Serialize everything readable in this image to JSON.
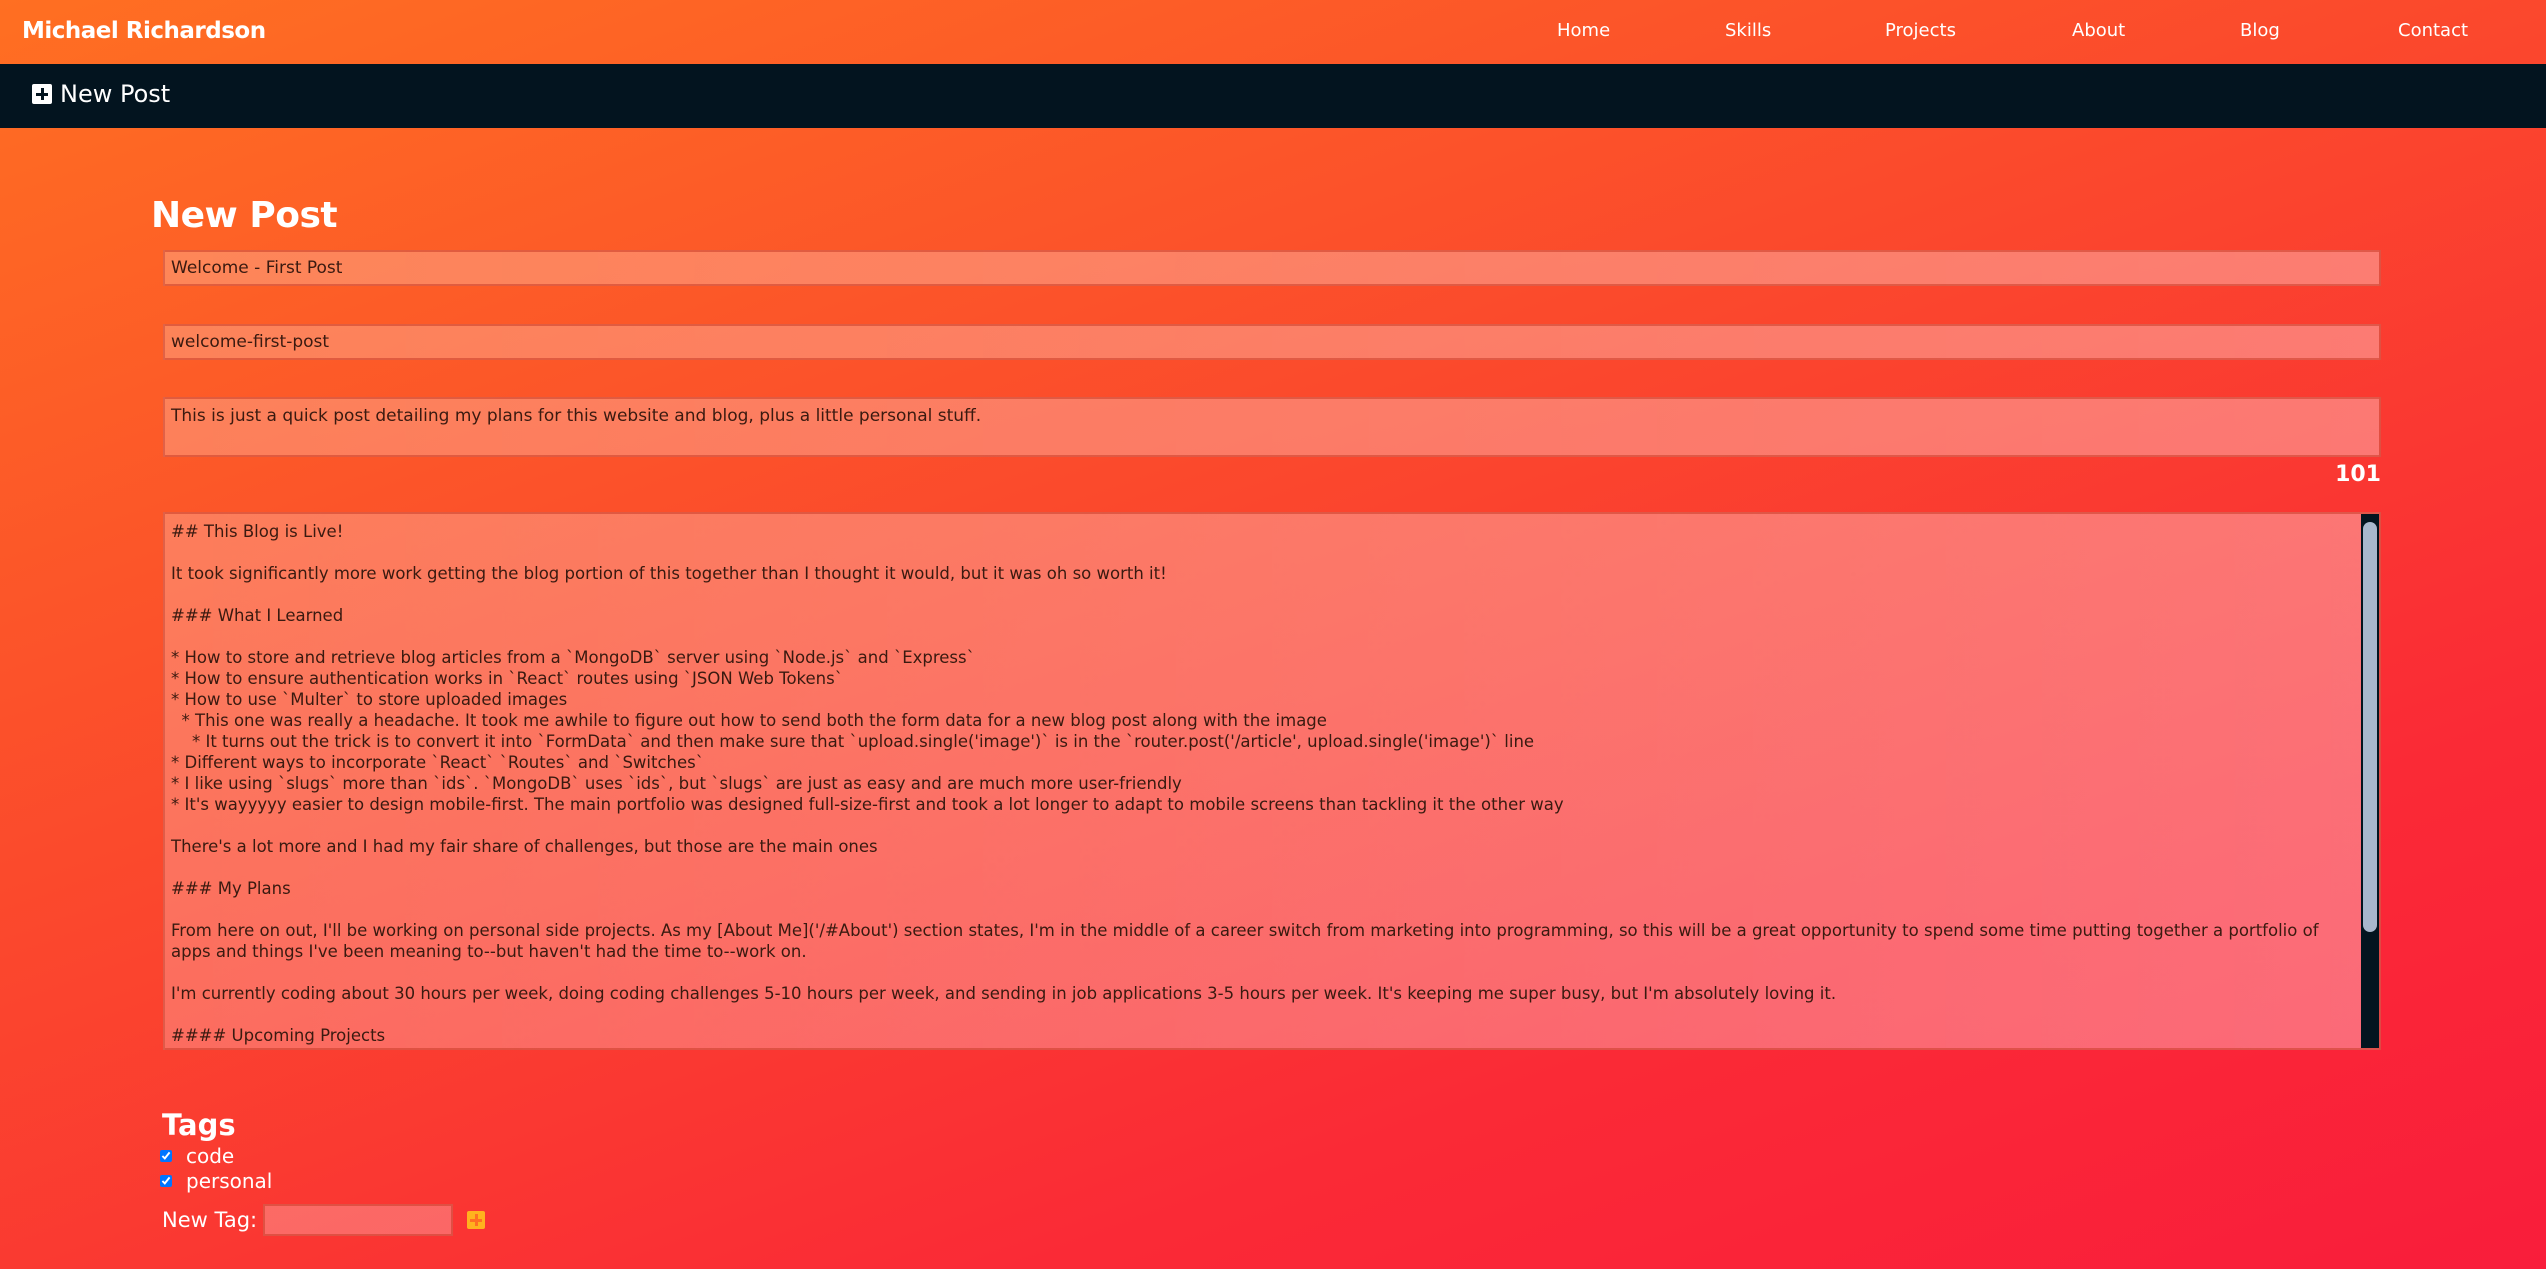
{
  "nav": {
    "brand": "Michael Richardson",
    "links": [
      {
        "label": "Home"
      },
      {
        "label": "Skills"
      },
      {
        "label": "Projects"
      },
      {
        "label": "About"
      },
      {
        "label": "Blog"
      },
      {
        "label": "Contact"
      }
    ]
  },
  "admin_bar": {
    "new_post_label": "New Post",
    "icon": "plus-square-icon"
  },
  "form": {
    "heading": "New Post",
    "title_value": "Welcome - First Post",
    "slug_value": "welcome-first-post",
    "excerpt_value": "This is just a quick post detailing my plans for this website and blog, plus a little personal stuff.",
    "excerpt_count": "101",
    "content_value": "## This Blog is Live!\n\nIt took significantly more work getting the blog portion of this together than I thought it would, but it was oh so worth it!\n\n### What I Learned\n\n* How to store and retrieve blog articles from a `MongoDB` server using `Node.js` and `Express`\n* How to ensure authentication works in `React` routes using `JSON Web Tokens`\n* How to use `Multer` to store uploaded images\n  * This one was really a headache. It took me awhile to figure out how to send both the form data for a new blog post along with the image\n    * It turns out the trick is to convert it into `FormData` and then make sure that `upload.single('image')` is in the `router.post('/article', upload.single('image')` line\n* Different ways to incorporate `React` `Routes` and `Switches`\n* I like using `slugs` more than `ids`. `MongoDB` uses `ids`, but `slugs` are just as easy and are much more user-friendly\n* It's wayyyyy easier to design mobile-first. The main portfolio was designed full-size-first and took a lot longer to adapt to mobile screens than tackling it the other way\n\nThere's a lot more and I had my fair share of challenges, but those are the main ones\n\n### My Plans\n\nFrom here on out, I'll be working on personal side projects. As my [About Me]('/#About') section states, I'm in the middle of a career switch from marketing into programming, so this will be a great opportunity to spend some time putting together a portfolio of apps and things I've been meaning to--but haven't had the time to--work on.\n\nI'm currently coding about 30 hours per week, doing coding challenges 5-10 hours per week, and sending in job applications 3-5 hours per week. It's keeping me super busy, but I'm absolutely loving it.\n\n#### Upcoming Projects"
  },
  "tags": {
    "heading": "Tags",
    "items": [
      {
        "label": "code",
        "checked": true
      },
      {
        "label": "personal",
        "checked": true
      }
    ],
    "new_tag_label": "New Tag:",
    "new_tag_value": "",
    "add_icon": "plus-square-icon"
  },
  "colors": {
    "gradient_start": "#ff6f22",
    "gradient_end": "#f91d3b",
    "admin_bar": "#03141f",
    "scroll_thumb": "#a8b7cc",
    "add_tag_icon": "#ffb21e"
  }
}
